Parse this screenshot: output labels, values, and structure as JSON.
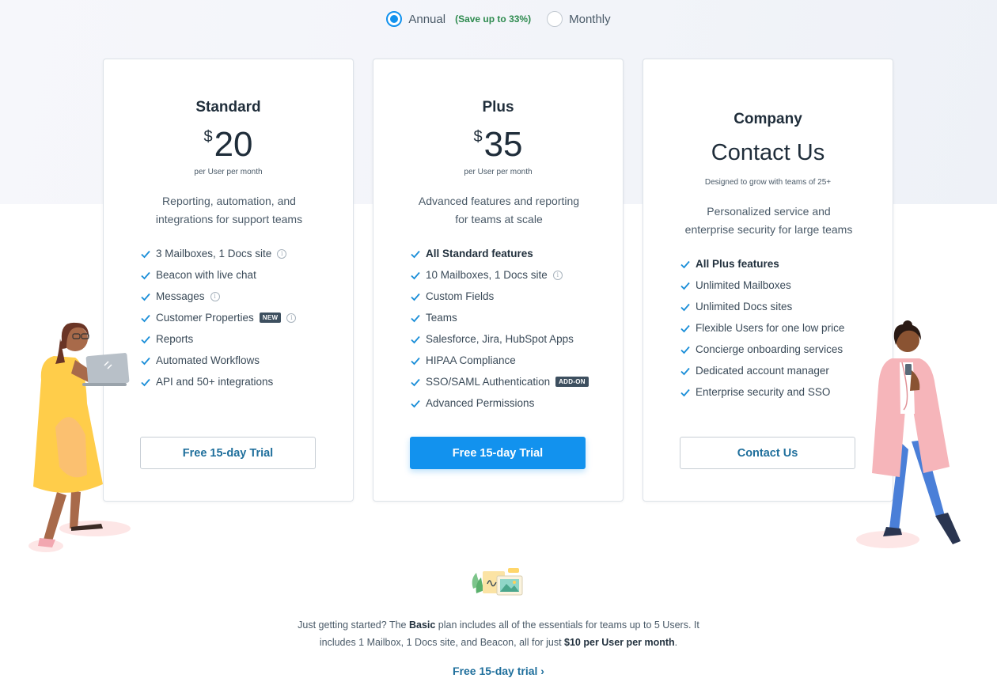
{
  "billing": {
    "annual_label": "Annual",
    "annual_note": "(Save up to 33%)",
    "monthly_label": "Monthly",
    "selected": "annual"
  },
  "colors": {
    "accent": "#1292ee",
    "link": "#1f6f9c",
    "save_green": "#2d8a4e",
    "text": "#314351"
  },
  "plans": {
    "standard": {
      "name": "Standard",
      "currency": "$",
      "price": "20",
      "price_sub": "per User per month",
      "desc_line1": "Reporting, automation, and",
      "desc_line2": "integrations for support teams",
      "features": [
        "3 Mailboxes, 1 Docs site",
        "Beacon with live chat",
        "Messages",
        "Customer Properties",
        "Reports",
        "Automated Workflows",
        "API and 50+ integrations"
      ],
      "new_tag": "NEW",
      "cta": "Free 15-day Trial"
    },
    "plus": {
      "name": "Plus",
      "currency": "$",
      "price": "35",
      "price_sub": "per User per month",
      "desc_line1": "Advanced features and reporting",
      "desc_line2": "for teams at scale",
      "features": [
        "All Standard features",
        "10 Mailboxes, 1 Docs site",
        "Custom Fields",
        "Teams",
        "Salesforce, Jira, HubSpot Apps",
        "HIPAA Compliance",
        "SSO/SAML Authentication",
        "Advanced Permissions"
      ],
      "addon_tag": "ADD-ON",
      "cta": "Free 15-day Trial"
    },
    "company": {
      "name": "Company",
      "price_text": "Contact Us",
      "price_sub": "Designed to grow with teams of 25+",
      "desc_line1": "Personalized service and",
      "desc_line2": "enterprise security for large teams",
      "features": [
        "All Plus features",
        "Unlimited Mailboxes",
        "Unlimited Docs sites",
        "Flexible Users for one low price",
        "Concierge onboarding services",
        "Dedicated account manager",
        "Enterprise security and SSO"
      ],
      "cta": "Contact Us"
    }
  },
  "basic": {
    "t1": "Just getting started? The ",
    "t2": "Basic",
    "t3": " plan includes all of the essentials for teams up to 5 Users. It includes 1 Mailbox, 1 Docs site, and Beacon, all for just ",
    "t4": "$10 per User per month",
    "t5": ".",
    "link": "Free 15-day trial",
    "link_arrow": "›"
  }
}
